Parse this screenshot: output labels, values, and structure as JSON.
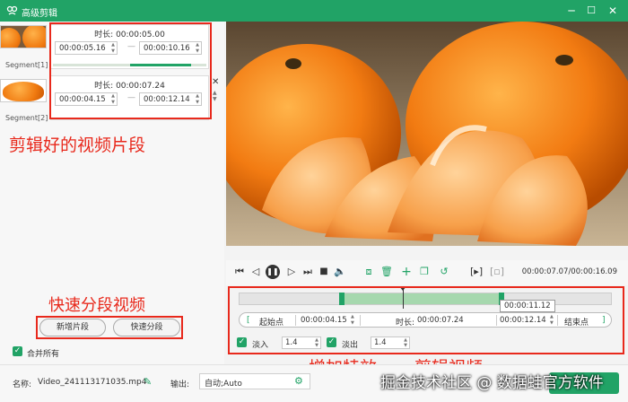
{
  "titlebar": {
    "title": "高级剪辑",
    "min": "─",
    "max": "☐",
    "close": "✕"
  },
  "segments": [
    {
      "label": "Segment[1]",
      "duration": "时长: 00:00:05.00",
      "start": "00:00:05.16",
      "end": "00:00:10.16"
    },
    {
      "label": "Segment[2]",
      "duration": "时长: 00:00:07.24",
      "start": "00:00:04.15",
      "end": "00:00:12.14"
    }
  ],
  "annotations": {
    "segments_clipped": "剪辑好的视频片段",
    "fast_split": "快速分段视频",
    "add_effects": "增加特效",
    "clip_video": "剪辑视频"
  },
  "left_buttons": {
    "new_segment": "新增片段",
    "fast_split": "快速分段"
  },
  "merge_all": "合并所有",
  "controls": {
    "time_readout": "00:00:07.07/00:00:16.09"
  },
  "timeline": {
    "tooltip": "00:00:11.12",
    "selection_start": 0.275,
    "selection_end": 0.705,
    "playhead": 0.44
  },
  "range": {
    "start_label": "起始点",
    "start_value": "00:00:04.15",
    "duration_label": "时长:",
    "duration_value": "00:00:07.24",
    "end_value": "00:00:12.14",
    "end_label": "结束点"
  },
  "fade": {
    "in_label": "淡入",
    "in_value": "1.4",
    "out_label": "淡出",
    "out_value": "1.4"
  },
  "bottom": {
    "name_label": "名称:",
    "name_value": "Video_241113171035.mp4",
    "output_label": "输出:",
    "output_value": "自动;Auto"
  },
  "watermark": "掘金技术社区 @ 数据蛙官方软件"
}
